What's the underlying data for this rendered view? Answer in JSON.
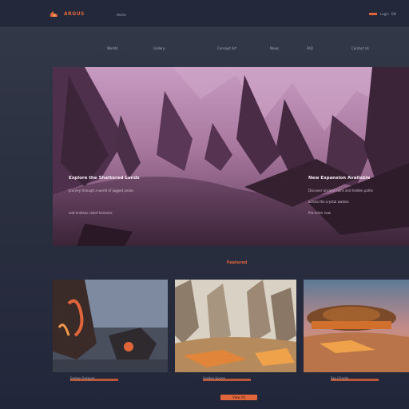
{
  "header": {
    "brand": "ARGUS",
    "top_link": "Home",
    "top_mini_1": "Login",
    "top_mini_2": "EN"
  },
  "nav": {
    "items": [
      "Worlds",
      "Gallery",
      "Concept Art",
      "News",
      "FAQ",
      "Contact Us"
    ]
  },
  "hero": {
    "left_title": "Explore the Shattered Lands",
    "left_line_1": "Journey through a world of jagged peaks",
    "left_line_2": "and endless violet horizons",
    "right_title": "New Expansion Available",
    "right_line_1": "Discover ancient ruins and hidden paths",
    "right_line_2": "across the crystal wastes",
    "right_line_3": "Pre-order now"
  },
  "section": {
    "label": "Featured"
  },
  "cards": [
    {
      "caption": "Ember Outpost"
    },
    {
      "caption": "Golden Spires"
    },
    {
      "caption": "Sky Citadel"
    }
  ],
  "footer": {
    "button_label": "View All"
  },
  "colors": {
    "accent": "#e0653a",
    "hero_purple": "#8a5a7e",
    "background": "#2b3040"
  }
}
